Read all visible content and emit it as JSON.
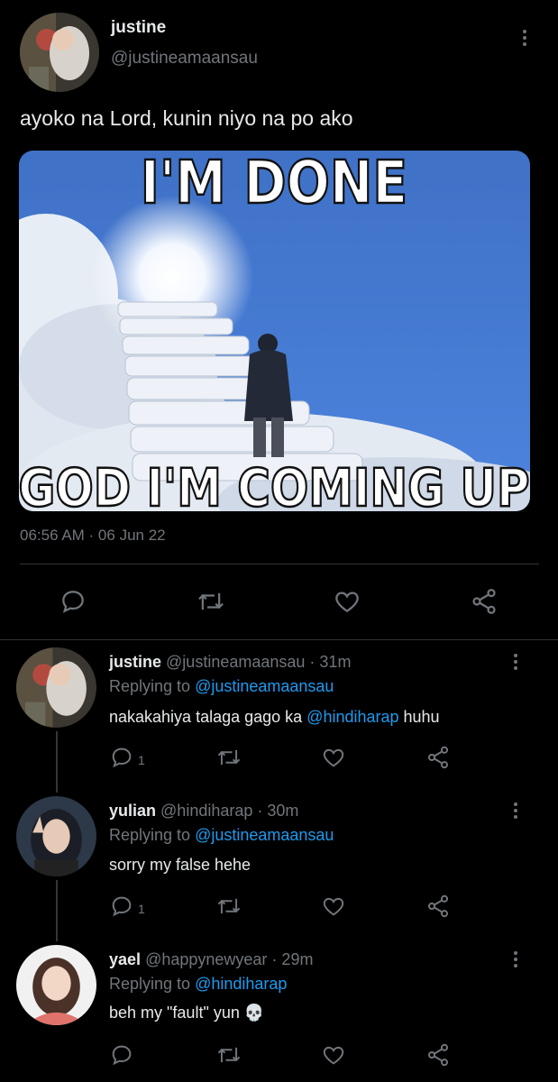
{
  "main_tweet": {
    "display_name": "justine",
    "handle": "@justineamaansau",
    "text": "ayoko na Lord, kunin niyo na po ako",
    "media": {
      "top_caption": "I'M DONE",
      "bottom_caption": "GOD I'M COMING UP"
    },
    "timestamp": "06:56 AM · 06 Jun 22"
  },
  "replies": [
    {
      "display_name": "justine",
      "handle": "@justineamaansau",
      "time": "· 31m",
      "replying_label": "Replying to",
      "replying_to": "@justineamaansau",
      "text_before": "nakakahiya talaga gago ka ",
      "mention": "@hindiharap",
      "text_after": " huhu",
      "reply_count": "1"
    },
    {
      "display_name": "yulian",
      "handle": "@hindiharap",
      "time": "· 30m",
      "replying_label": "Replying to",
      "replying_to": "@justineamaansau",
      "text": "sorry my false hehe",
      "reply_count": "1"
    },
    {
      "display_name": "yael",
      "handle": "@happynewyear",
      "time": "· 29m",
      "replying_label": "Replying to",
      "replying_to": "@hindiharap",
      "text": "beh my \"fault\" yun",
      "emoji": "💀",
      "reply_count": ""
    }
  ],
  "icons": {
    "reply": "reply-icon",
    "retweet": "retweet-icon",
    "like": "heart-icon",
    "share": "share-icon",
    "more": "more-vertical-icon"
  },
  "colors": {
    "background": "#000000",
    "text": "#e7e9ea",
    "secondary": "#71767b",
    "link": "#1d9bf0",
    "divider": "#2f3336"
  }
}
